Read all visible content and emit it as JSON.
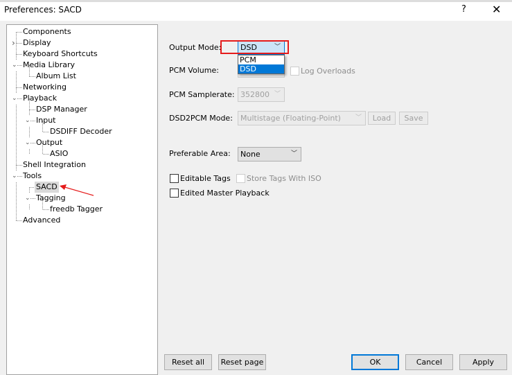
{
  "window": {
    "title": "Preferences: SACD",
    "help": "?",
    "close": "✕"
  },
  "tree": [
    {
      "label": "Components",
      "level": 0
    },
    {
      "label": "Display",
      "level": 0,
      "expander": "collapsed"
    },
    {
      "label": "Keyboard Shortcuts",
      "level": 0
    },
    {
      "label": "Media Library",
      "level": 0,
      "expander": "expanded"
    },
    {
      "label": "Album List",
      "level": 1
    },
    {
      "label": "Networking",
      "level": 0
    },
    {
      "label": "Playback",
      "level": 0,
      "expander": "expanded"
    },
    {
      "label": "DSP Manager",
      "level": 1
    },
    {
      "label": "Input",
      "level": 1,
      "expander": "expanded"
    },
    {
      "label": "DSDIFF Decoder",
      "level": 2
    },
    {
      "label": "Output",
      "level": 1,
      "expander": "expanded"
    },
    {
      "label": "ASIO",
      "level": 2
    },
    {
      "label": "Shell Integration",
      "level": 0
    },
    {
      "label": "Tools",
      "level": 0,
      "expander": "expanded"
    },
    {
      "label": "SACD",
      "level": 1,
      "selected": true
    },
    {
      "label": "Tagging",
      "level": 1,
      "expander": "expanded"
    },
    {
      "label": "freedb Tagger",
      "level": 2
    },
    {
      "label": "Advanced",
      "level": 0
    }
  ],
  "settings": {
    "output_mode_label": "Output Mode:",
    "output_mode_value": "DSD",
    "output_mode_options": [
      "PCM",
      "DSD"
    ],
    "pcm_volume_label": "PCM Volume:",
    "log_overloads": "Log Overloads",
    "pcm_samplerate_label": "PCM Samplerate:",
    "pcm_samplerate_value": "352800",
    "dsd2pcm_label": "DSD2PCM Mode:",
    "dsd2pcm_value": "Multistage (Floating-Point)",
    "load": "Load",
    "save": "Save",
    "preferable_area_label": "Preferable Area:",
    "preferable_area_value": "None",
    "editable_tags": "Editable Tags",
    "store_tags_iso": "Store Tags With ISO",
    "edited_master": "Edited Master Playback"
  },
  "buttons": {
    "reset_all": "Reset all",
    "reset_page": "Reset page",
    "ok": "OK",
    "cancel": "Cancel",
    "apply": "Apply"
  },
  "annotation_colors": {
    "highlight_box": "#e51b1b",
    "arrow": "#e51b1b",
    "selection": "#0078d7"
  }
}
